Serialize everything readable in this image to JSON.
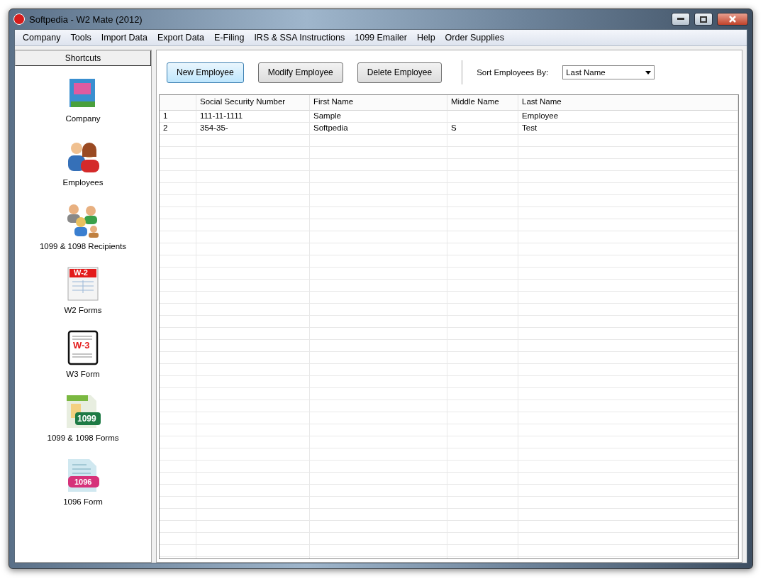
{
  "window": {
    "title": "Softpedia - W2 Mate (2012)"
  },
  "menu": [
    "Company",
    "Tools",
    "Import Data",
    "Export Data",
    "E-Filing",
    "IRS & SSA Instructions",
    "1099 Emailer",
    "Help",
    "Order Supplies"
  ],
  "sidebar": {
    "title": "Shortcuts",
    "items": [
      {
        "kind": "building",
        "label": "Company"
      },
      {
        "kind": "people",
        "label": "Employees"
      },
      {
        "kind": "group",
        "label": "1099 & 1098 Recipients"
      },
      {
        "kind": "w2",
        "label": "W2 Forms",
        "badge": "W-2"
      },
      {
        "kind": "w3",
        "label": "W3 Form",
        "badge": "W-3"
      },
      {
        "kind": "f1099",
        "label": "1099 & 1098 Forms",
        "badge": "1099"
      },
      {
        "kind": "f1096",
        "label": "1096 Form",
        "badge": "1096"
      }
    ]
  },
  "toolbar": {
    "buttons": [
      {
        "label": "New Employee",
        "selected": true
      },
      {
        "label": "Modify Employee",
        "selected": false
      },
      {
        "label": "Delete Employee",
        "selected": false
      }
    ],
    "sort_label": "Sort Employees By:",
    "sort_value": "Last Name"
  },
  "table": {
    "columns": [
      "",
      "Social Security Number",
      "First Name",
      "Middle Name",
      "Last Name"
    ],
    "rows": [
      [
        "1",
        "111-11-1111",
        "Sample",
        "",
        "Employee"
      ],
      [
        "2",
        "354-35-",
        "Softpedia",
        "S",
        "Test"
      ]
    ]
  }
}
